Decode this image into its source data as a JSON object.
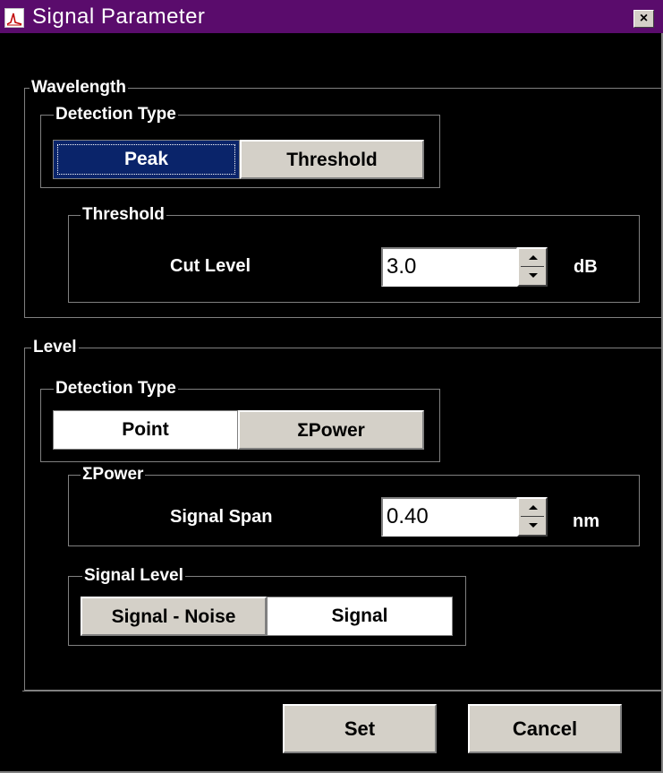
{
  "window": {
    "title": "Signal Parameter",
    "close_glyph": "×",
    "icon": "spectrum-icon",
    "colors": {
      "titlebar": "#5a0c6c",
      "selected": "#0a246a",
      "background": "#000000"
    }
  },
  "wavelength": {
    "group_label": "Wavelength",
    "detection": {
      "group_label": "Detection Type",
      "options": [
        "Peak",
        "Threshold"
      ],
      "selected": "Peak"
    },
    "threshold": {
      "group_label": "Threshold",
      "cut_level_label": "Cut Level",
      "cut_level_value": "3.0",
      "unit": "dB"
    }
  },
  "level": {
    "group_label": "Level",
    "detection": {
      "group_label": "Detection Type",
      "options": [
        "Point",
        "ΣPower"
      ],
      "selected": "Point"
    },
    "power": {
      "group_label": "ΣPower",
      "span_label": "Signal Span",
      "span_value": "0.40",
      "unit": "nm"
    },
    "signal_level": {
      "group_label": "Signal Level",
      "options": [
        "Signal - Noise",
        "Signal"
      ],
      "selected": "Signal"
    }
  },
  "buttons": {
    "set": "Set",
    "cancel": "Cancel"
  }
}
